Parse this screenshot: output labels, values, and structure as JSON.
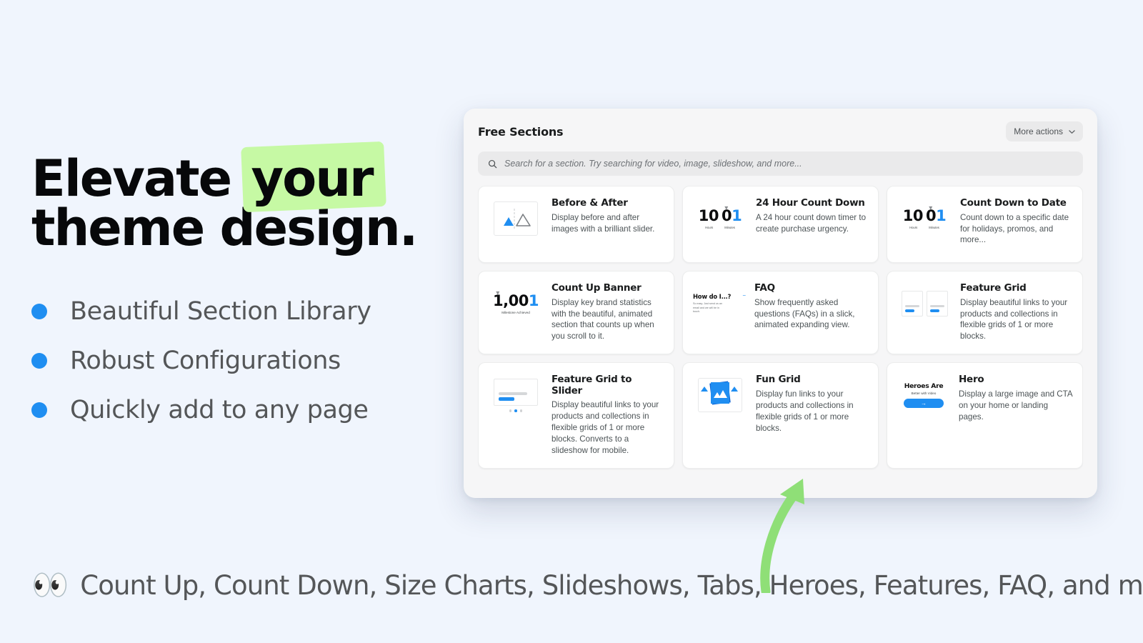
{
  "hero": {
    "headline_line1_prefix": "Elevate",
    "headline_highlight": "your",
    "headline_line2": "theme design.",
    "highlight_color": "#c6f9a4",
    "bullets": [
      {
        "label": "Beautiful Section Library",
        "bullet_color": "#1f8ef1"
      },
      {
        "label": "Robust Configurations",
        "bullet_color": "#1f8ef1"
      },
      {
        "label": "Quickly add to any page",
        "bullet_color": "#1f8ef1"
      }
    ]
  },
  "caption": {
    "emoji": "👀",
    "text": "Count Up, Count Down, Size Charts, Slideshows, Tabs, Heroes, Features, FAQ, and more."
  },
  "app": {
    "title": "Free Sections",
    "more_actions_label": "More actions",
    "more_actions_icon": "chevron-down-icon",
    "search": {
      "icon": "search-icon",
      "placeholder": "Search for a section. Try searching for video, image, slideshow, and more...",
      "value": ""
    },
    "accent_color": "#1f8ef1",
    "cards": [
      {
        "title": "Before & After",
        "desc": "Display before and after images with a brilliant slider.",
        "thumb": "before-after-thumb"
      },
      {
        "title": "24 Hour Count Down",
        "desc": "A 24 hour count down timer to create purchase urgency.",
        "thumb": "count-down-thumb",
        "thumb_digits_left": "10",
        "thumb_digits_right": "0",
        "thumb_label_left": "Hours",
        "thumb_label_right": "Minutes"
      },
      {
        "title": "Count Down to Date",
        "desc": "Count down to a specific date for holidays, promos, and more...",
        "thumb": "count-down-thumb",
        "thumb_digits_left": "10",
        "thumb_digits_right": "0",
        "thumb_label_left": "Hours",
        "thumb_label_right": "Minutes"
      },
      {
        "title": "Count Up Banner",
        "desc": "Display key brand statistics with the beautiful, animated section that counts up when you scroll to it.",
        "thumb": "count-up-thumb",
        "thumb_digits": "1,00",
        "thumb_sub": "Milestone Achieved"
      },
      {
        "title": "FAQ",
        "desc": "Show frequently asked questions (FAQs) in a slick, animated expanding view.",
        "thumb": "faq-thumb",
        "thumb_question": "How do I...?",
        "thumb_answer": "So easy. Just send us an email and we will be in touch.",
        "thumb_toggle": "minus-icon"
      },
      {
        "title": "Feature Grid",
        "desc": "Display beautiful links to your products and collections in flexible grids of 1 or more blocks.",
        "thumb": "feature-grid-thumb"
      },
      {
        "title": "Feature Grid to Slider",
        "desc": "Display beautiful links to your products and collections in flexible grids of 1 or more blocks. Converts to a slideshow for mobile.",
        "thumb": "feature-grid-slider-thumb"
      },
      {
        "title": "Fun Grid",
        "desc": "Display fun links to your products and collections in flexible grids of 1 or more blocks.",
        "thumb": "fun-grid-thumb"
      },
      {
        "title": "Hero",
        "desc": "Display a large image and CTA on your home or landing pages.",
        "thumb": "hero-thumb",
        "thumb_title": "Heroes Are",
        "thumb_sub": "Better with Video",
        "thumb_button_icon": "arrow-right-icon"
      }
    ]
  },
  "annotation": {
    "arrow_color": "#8fdf77",
    "points_to": "fun-grid-thumb"
  }
}
